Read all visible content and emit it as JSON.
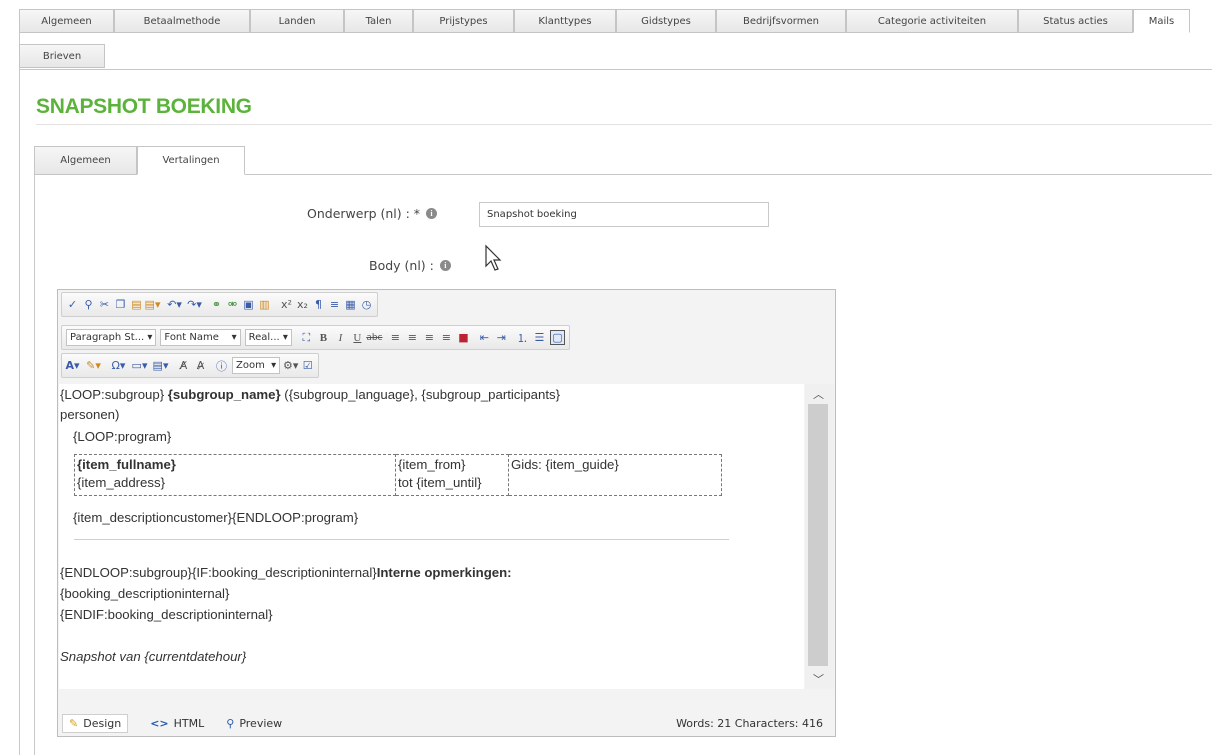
{
  "top_tabs": [
    "Algemeen",
    "Betaalmethode",
    "Landen",
    "Talen",
    "Prijstypes",
    "Klanttypes",
    "Gidstypes",
    "Bedrijfsvormen",
    "Categorie activiteiten",
    "Status acties",
    "Mails",
    "Brieven"
  ],
  "page_title": "SNAPSHOT BOEKING",
  "sub_tabs": [
    "Algemeen",
    "Vertalingen"
  ],
  "form": {
    "subject_label": "Onderwerp (nl) : *",
    "subject_value": "Snapshot boeking",
    "body_label": "Body (nl) :"
  },
  "toolbar": {
    "paragraph_style": "Paragraph St...",
    "font_name": "Font Name",
    "font_size": "Real...",
    "zoom": "Zoom"
  },
  "content": {
    "line1_a": "{LOOP:subgroup} ",
    "line1_b": "{subgroup_name}",
    "line1_c": " ({subgroup_language}, {subgroup_participants}",
    "line2": "personen)",
    "line3": "{LOOP:program}",
    "cell_fullname": "{item_fullname}",
    "cell_address": "{item_address}",
    "cell_from": "{item_from}",
    "cell_until": "tot {item_until}",
    "cell_guide": "Gids: {item_guide}",
    "line_description": "{item_descriptioncustomer}{ENDLOOP:program}",
    "line_endloop": "{ENDLOOP:subgroup}{IF:booking_descriptioninternal}",
    "line_endloop_bold": "Interne opmerkingen:",
    "line_internal": "{booking_descriptioninternal}",
    "line_endif": "{ENDIF:booking_descriptioninternal}",
    "line_snapshot": "Snapshot van {currentdatehour}"
  },
  "footer": {
    "design": "Design",
    "html": "HTML",
    "preview": "Preview",
    "stats": "Words: 21  Characters: 416"
  }
}
